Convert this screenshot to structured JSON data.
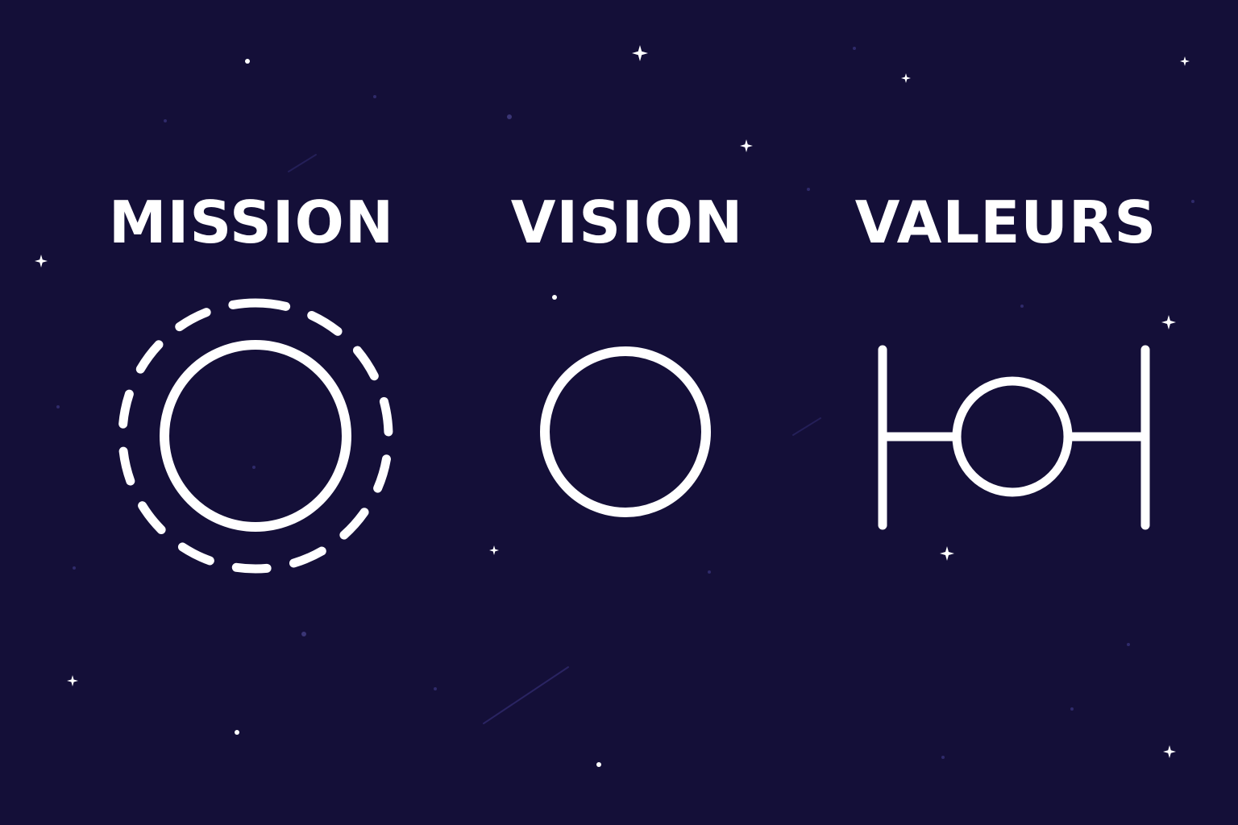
{
  "colors": {
    "background": "#140f38",
    "foreground": "#ffffff",
    "star_dim": "#3a3575"
  },
  "sections": [
    {
      "id": "mission",
      "label": "MISSION",
      "icon": "concentric-dashed-circle-icon"
    },
    {
      "id": "vision",
      "label": "VISION",
      "icon": "circle-icon"
    },
    {
      "id": "valeurs",
      "label": "VALEURS",
      "icon": "balance-circle-icon"
    }
  ]
}
